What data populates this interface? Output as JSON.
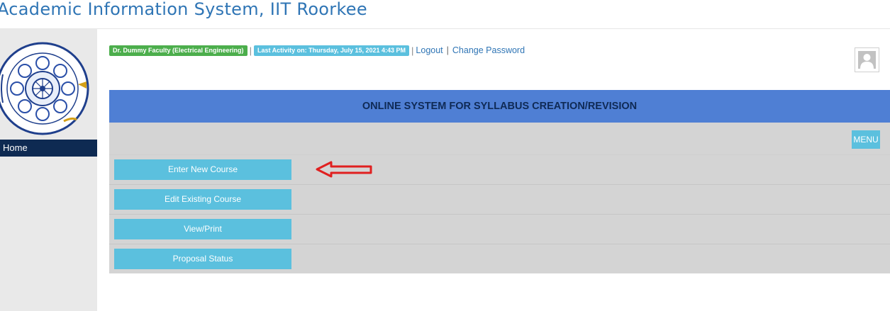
{
  "header": {
    "app_title": "Academic Information System, IIT Roorkee"
  },
  "sidebar": {
    "items": [
      {
        "label": "Home"
      }
    ]
  },
  "status": {
    "user_badge": "Dr. Dummy Faculty (Electrical Engineering)",
    "activity_badge": "Last Activity on: Thursday, July 15, 2021 4:43 PM",
    "separator": "|",
    "logout": "Logout",
    "link_separator": "|",
    "change_password": "Change Password"
  },
  "banner": {
    "title": "ONLINE SYSTEM FOR SYLLABUS CREATION/REVISION"
  },
  "toolbar": {
    "menu_label": "MENU"
  },
  "actions": [
    {
      "label": "Enter New Course"
    },
    {
      "label": "Edit Existing Course"
    },
    {
      "label": "View/Print"
    },
    {
      "label": "Proposal Status"
    }
  ],
  "colors": {
    "banner": "#4f7fd4",
    "button": "#5bc0de",
    "user_badge": "#4cae4c",
    "nav_active": "#0e2a52",
    "annotation_arrow": "#e02020"
  },
  "icons": {
    "logo": "iit-roorkee-emblem-icon",
    "avatar": "user-avatar-icon",
    "annotation": "left-arrow-icon"
  }
}
